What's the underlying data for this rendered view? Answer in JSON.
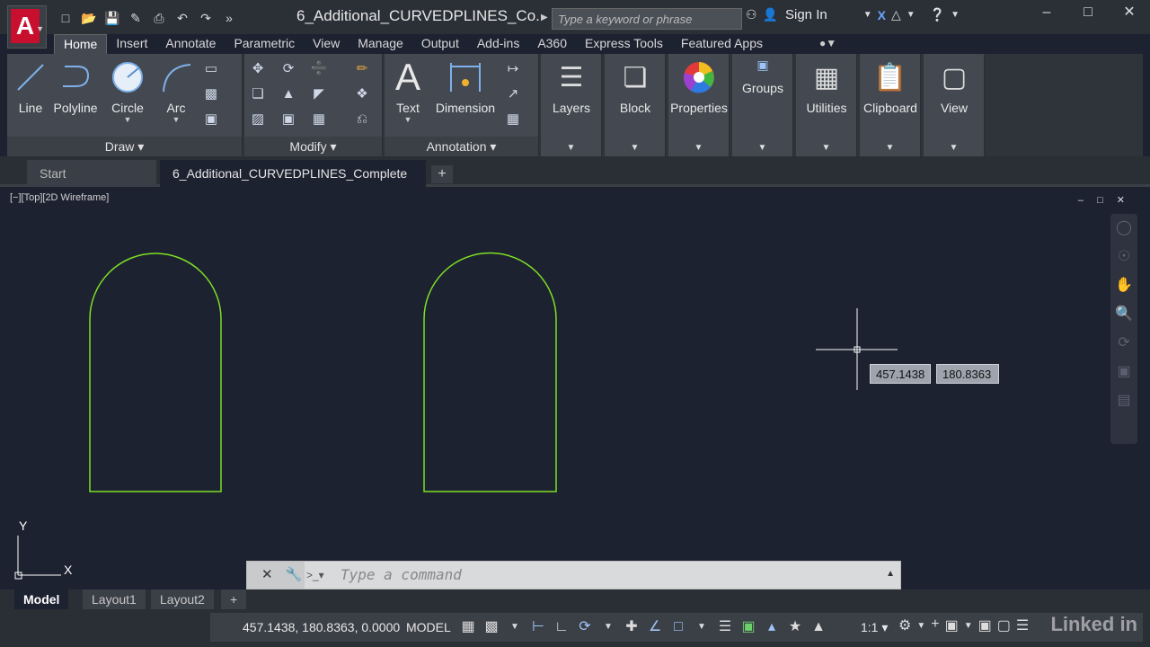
{
  "app": {
    "logo": "A"
  },
  "title": "6_Additional_CURVEDPLINES_Co...",
  "search": {
    "placeholder": "Type a keyword or phrase"
  },
  "account": {
    "sign_in": "Sign In"
  },
  "ribbon_tabs": [
    "Home",
    "Insert",
    "Annotate",
    "Parametric",
    "View",
    "Manage",
    "Output",
    "Add-ins",
    "A360",
    "Express Tools",
    "Featured Apps"
  ],
  "active_ribbon_tab": "Home",
  "draw_panel": {
    "title": "Draw",
    "tools": [
      "Line",
      "Polyline",
      "Circle",
      "Arc"
    ]
  },
  "modify_panel": {
    "title": "Modify"
  },
  "annotation_panel": {
    "title": "Annotation",
    "tools": [
      "Text",
      "Dimension"
    ]
  },
  "big_tools": [
    "Layers",
    "Block",
    "Properties",
    "Groups",
    "Utilities",
    "Clipboard",
    "View"
  ],
  "file_tabs": [
    {
      "label": "Start"
    },
    {
      "label": "6_Additional_CURVEDPLINES_Complete"
    }
  ],
  "viewport": {
    "label": "[−][Top][2D Wireframe]",
    "controls": "– □ ✕"
  },
  "cursor": {
    "x_value": "457.1438",
    "y_value": "180.8363"
  },
  "ucs": {
    "x_label": "X",
    "y_label": "Y"
  },
  "command_line": {
    "placeholder": "Type a command"
  },
  "layout_tabs": [
    "Model",
    "Layout1",
    "Layout2"
  ],
  "status": {
    "coords": "457.1438, 180.8363, 0.0000",
    "space": "MODEL",
    "scale": "1:1"
  },
  "watermark": "Linked in",
  "colors": {
    "shape_stroke": "#7ddf24",
    "canvas_bg": "#1d2230"
  }
}
